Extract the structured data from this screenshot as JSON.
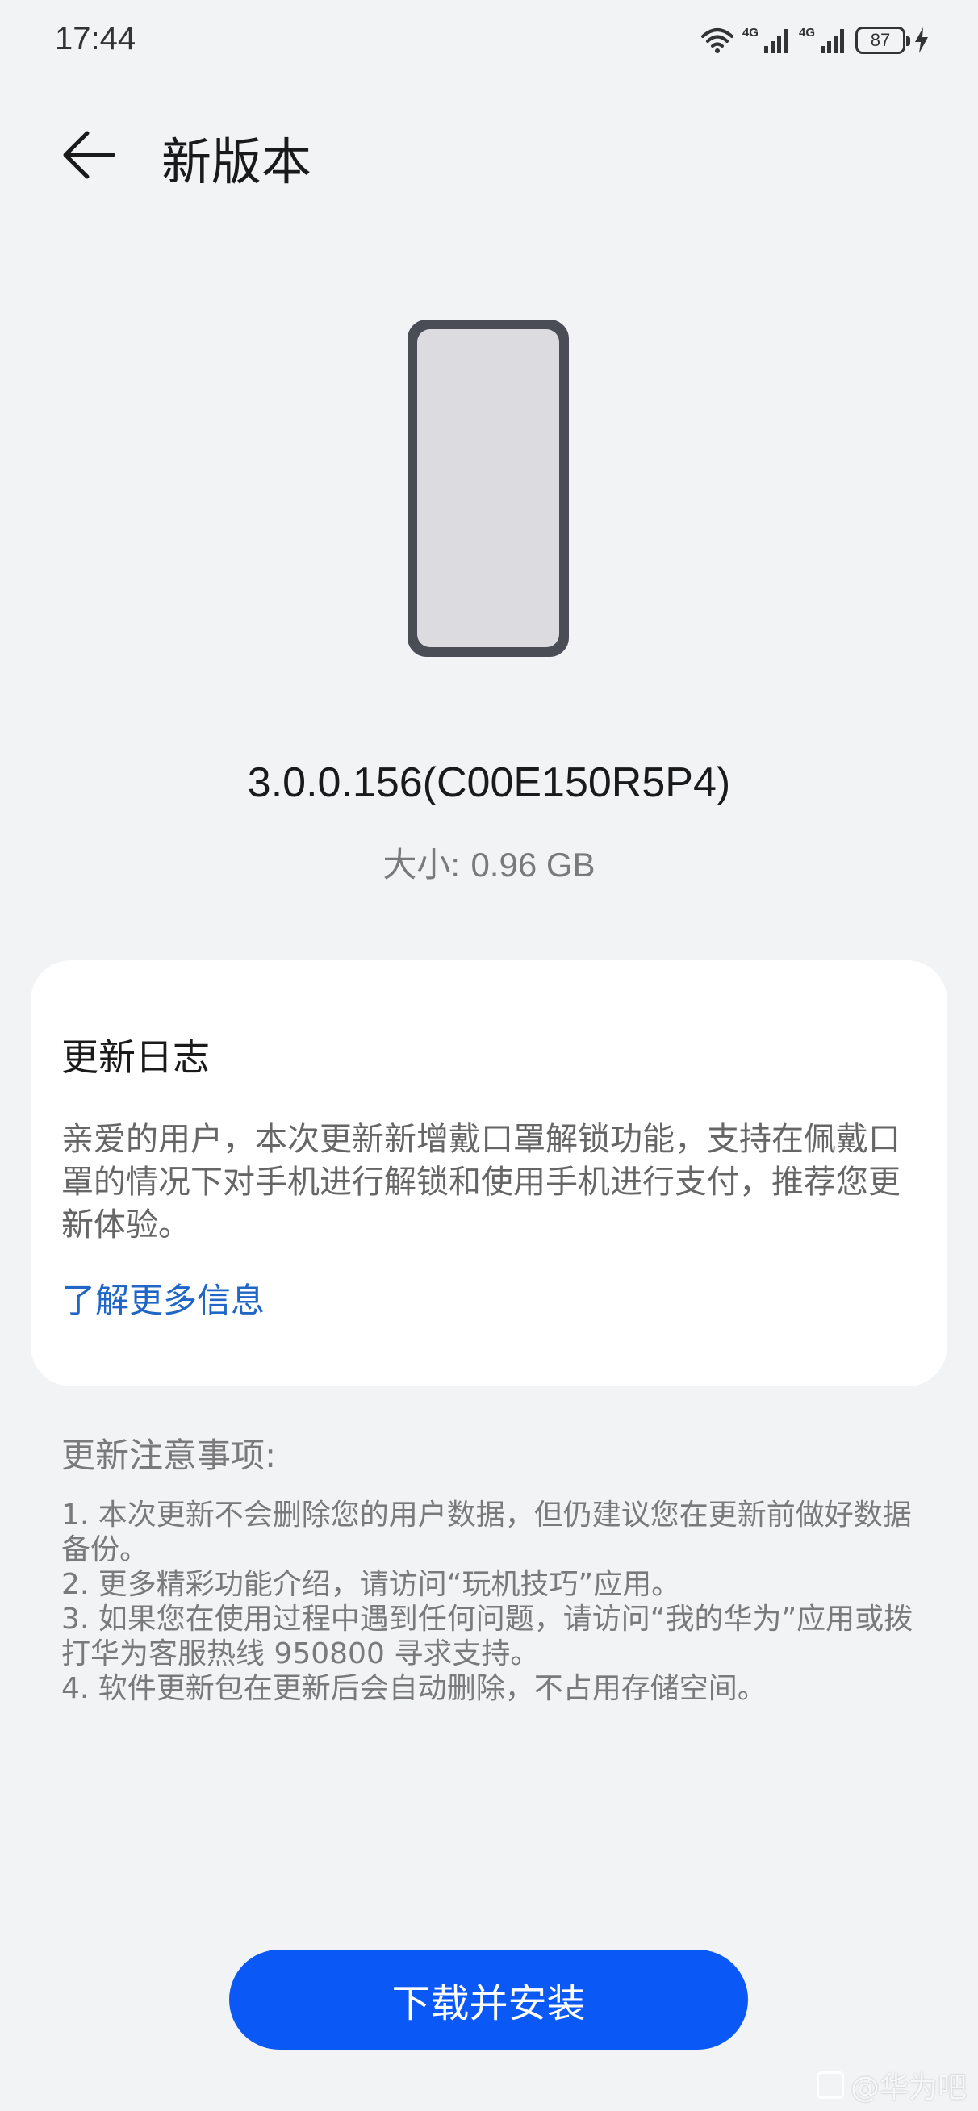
{
  "status_bar": {
    "time": "17:44",
    "signal1_label": "4G",
    "signal2_label": "4G",
    "battery": "87"
  },
  "header": {
    "title": "新版本"
  },
  "update": {
    "version": "3.0.0.156(C00E150R5P4)",
    "size_label": "大小:",
    "size_value": "0.96 GB"
  },
  "changelog": {
    "title": "更新日志",
    "body": "亲爱的用户，本次更新新增戴口罩解锁功能，支持在佩戴口罩的情况下对手机进行解锁和使用手机进行支付，推荐您更新体验。",
    "more_link": "了解更多信息"
  },
  "notes": {
    "title": "更新注意事项:",
    "items": [
      "1. 本次更新不会删除您的用户数据，但仍建议您在更新前做好数据备份。",
      "2. 更多精彩功能介绍，请访问“玩机技巧”应用。",
      "3. 如果您在使用过程中遇到任何问题，请访问“我的华为”应用或拨打华为客服热线 950800 寻求支持。",
      "4. 软件更新包在更新后会自动删除，不占用存储空间。"
    ]
  },
  "actions": {
    "install": "下载并安装"
  },
  "watermark": {
    "text": "@华为吧"
  },
  "colors": {
    "background": "#f1f3f5",
    "accent": "#0a59f7",
    "link": "#1f66c7"
  }
}
